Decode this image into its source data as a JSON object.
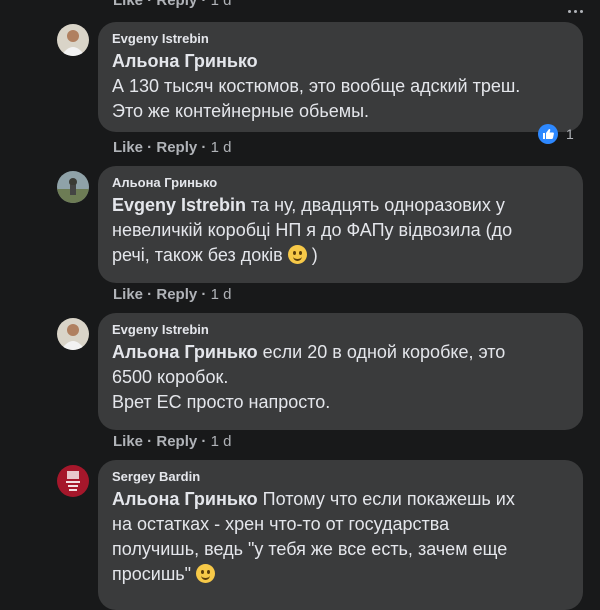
{
  "top_actions": {
    "like": "Like",
    "reply": "Reply",
    "time": "1 d"
  },
  "comments": [
    {
      "author": "Evgeny Istrebin",
      "mention": "Альона Гринько",
      "lines": [
        "А 130 тысяч костюмов, это вообще адский треш.",
        "Это же контейнерные обьемы."
      ],
      "like": "Like",
      "reply": "Reply",
      "time": "1 d",
      "reaction_count": "1"
    },
    {
      "author": "Альона Гринько",
      "mention": "Evgeny Istrebin",
      "line1_rest": " та ну, двадцять одноразових у",
      "line2": "невеличкій коробці НП я до ФАПу відвозила (до",
      "line3a": "речі, також без доків ",
      "line3b": " )",
      "like": "Like",
      "reply": "Reply",
      "time": "1 d"
    },
    {
      "author": "Evgeny Istrebin",
      "mention": "Альона Гринько",
      "line1_rest": " если 20 в одной коробке, это",
      "line2": "6500 коробок.",
      "line3": "Врет ЕС просто напросто.",
      "like": "Like",
      "reply": "Reply",
      "time": "1 d"
    },
    {
      "author": "Sergey Bardin",
      "mention": "Альона Гринько",
      "line1_rest": " Потому что если покажешь их",
      "line2": "на остатках - хрен что-то от государства",
      "line3": "получишь, ведь \"у тебя же все есть, зачем еще",
      "line4": "просишь\" "
    }
  ],
  "colors": {
    "background": "#18191a",
    "bubble": "#3a3b3c",
    "text": "#e4e6eb",
    "muted": "#b0b3b8",
    "like_blue": "#2d88ff"
  }
}
